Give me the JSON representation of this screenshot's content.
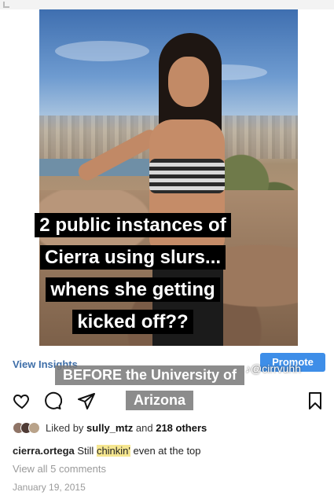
{
  "post": {
    "overlay_caption_lines": [
      "2 public instances of",
      "Cierra using slurs...",
      "whens she getting",
      "kicked off??"
    ],
    "insights_label": "View Insights",
    "promote_label": "Promote",
    "tiktok_watermark": "@cirrvuhh",
    "banner_line_1": "BEFORE the University of",
    "banner_line_2": "Arizona",
    "likes_prefix": "Liked by ",
    "likes_user": "sully_mtz",
    "likes_suffix": " and ",
    "likes_count": "218 others",
    "caption_user": "cierra.ortega",
    "caption_pre": " Still ",
    "caption_highlight": "chinkin'",
    "caption_post": " even at the top",
    "view_comments": "View all 5 comments",
    "date": "January 19, 2015"
  },
  "icons": [
    "heart-icon",
    "comment-icon",
    "share-icon",
    "bookmark-icon"
  ],
  "colors": {
    "link_blue": "#3e6ea8",
    "promote_blue": "#3e8ee8",
    "highlight": "#f5e690"
  }
}
